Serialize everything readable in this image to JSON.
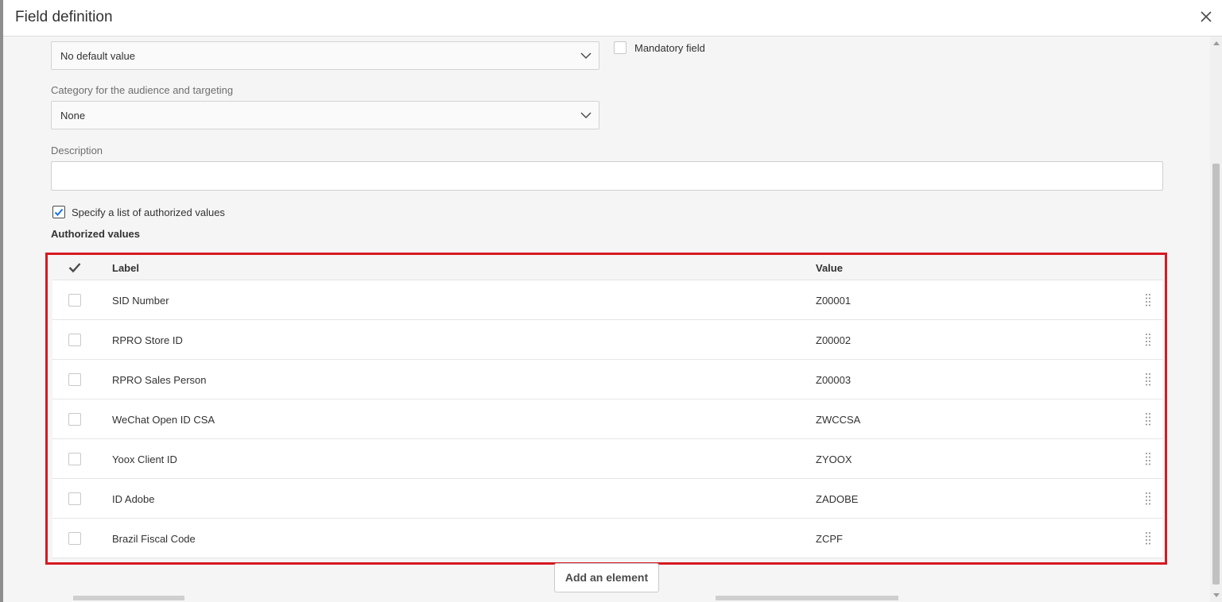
{
  "dialog": {
    "title": "Field definition",
    "close_icon": "close-icon"
  },
  "form": {
    "default_value": {
      "value": "No default value"
    },
    "mandatory": {
      "label": "Mandatory field",
      "checked": false
    },
    "category": {
      "label": "Category for the audience and targeting",
      "value": "None"
    },
    "description": {
      "label": "Description",
      "value": ""
    },
    "authorized_list": {
      "label": "Specify a list of authorized values",
      "checked": true
    },
    "authorized_heading": "Authorized values"
  },
  "table": {
    "columns": {
      "label": "Label",
      "value": "Value"
    },
    "rows": [
      {
        "label": "SID Number",
        "value": "Z00001"
      },
      {
        "label": "RPRO Store ID",
        "value": "Z00002"
      },
      {
        "label": "RPRO Sales Person",
        "value": "Z00003"
      },
      {
        "label": "WeChat Open ID CSA",
        "value": "ZWCCSA"
      },
      {
        "label": "Yoox Client ID",
        "value": "ZYOOX"
      },
      {
        "label": "ID Adobe",
        "value": "ZADOBE"
      },
      {
        "label": "Brazil Fiscal Code",
        "value": "ZCPF"
      }
    ]
  },
  "actions": {
    "add_element": "Add an element"
  },
  "colors": {
    "highlight": "#d71921",
    "text": "#323232",
    "background": "#f5f5f5"
  }
}
